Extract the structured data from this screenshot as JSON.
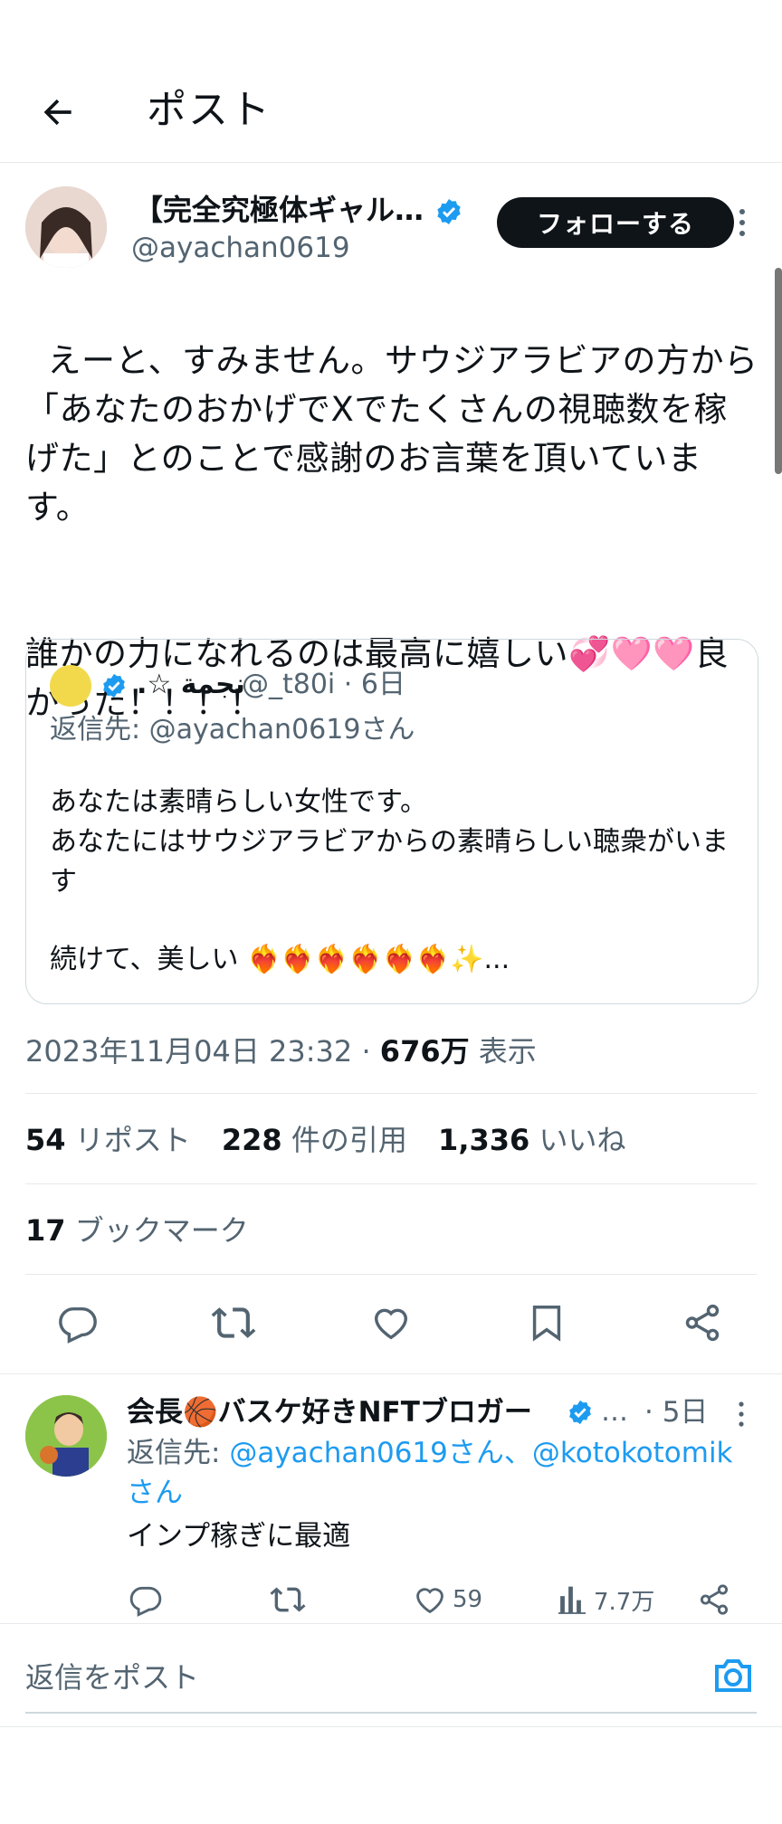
{
  "header": {
    "title": "ポスト"
  },
  "post": {
    "author_name": "【完全究極体ギャル…",
    "author_handle": "@ayachan0619",
    "follow_label": "フォローする",
    "body_line1": "えーと、すみません。サウジアラビアの方から「あなたのおかげでXでたくさんの視聴数を稼げた」とのことで感謝のお言葉を頂いています。",
    "body_line2": "誰かの力になれるのは最高に嬉しい💞🩷🩷良かった！！！！",
    "timestamp": "2023年11月04日 23:32 · ",
    "views_count": "676万",
    "views_label": " 表示"
  },
  "quote": {
    "name": ".☆ نجمة",
    "meta": "@_t80i · 6日",
    "reply_to": "返信先: @ayachan0619さん",
    "text_line1": "あなたは素晴らしい女性です。",
    "text_line2": "あなたにはサウジアラビアからの素晴らしい聴衆がいます",
    "text_line3": "続けて、美しい ❤️‍🔥❤️‍🔥❤️‍🔥❤️‍🔥❤️‍🔥❤️‍🔥✨..."
  },
  "stats": {
    "reposts_num": "54",
    "reposts_label": " リポスト",
    "quotes_num": "228",
    "quotes_label": " 件の引用",
    "likes_num": "1,336",
    "likes_label": " いいね",
    "bookmarks_num": "17",
    "bookmarks_label": " ブックマーク"
  },
  "reply": {
    "name": "会長🏀バスケ好きNFTブロガー",
    "ellipsis": "…",
    "time": "· 5日",
    "reply_prefix": "返信先: ",
    "reply_mentions": "@ayachan0619さん、@kotokotomikさん",
    "text": "インプ稼ぎに最適",
    "likes": "59",
    "views": "7.7万"
  },
  "composer": {
    "placeholder": "返信をポスト"
  },
  "colors": {
    "accent": "#1d9bf0",
    "text": "#0f1419",
    "muted": "#536471",
    "border": "#e6e9ec"
  },
  "icons": [
    "back-arrow-icon",
    "verified-badge-icon",
    "more-vertical-icon",
    "reply-icon",
    "repost-icon",
    "like-icon",
    "bookmark-icon",
    "share-icon",
    "views-icon",
    "camera-icon"
  ]
}
